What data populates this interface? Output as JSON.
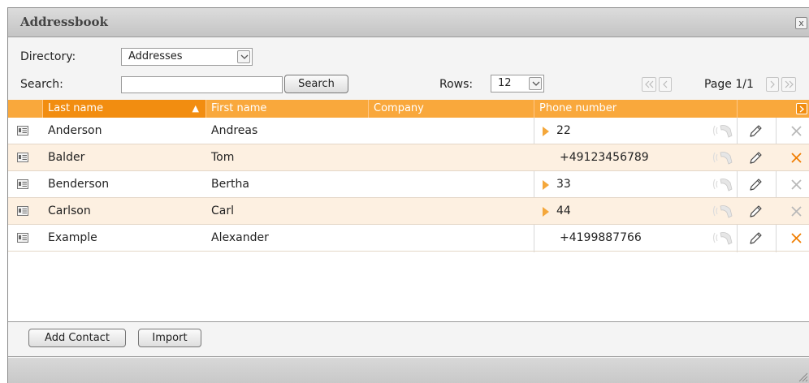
{
  "window": {
    "title": "Addressbook",
    "close_label": "x"
  },
  "toolbar": {
    "directory_label": "Directory:",
    "directory_value": "Addresses",
    "search_label": "Search:",
    "search_value": "",
    "search_button": "Search",
    "rows_label": "Rows:",
    "rows_value": "12",
    "page_label": "Page 1/1"
  },
  "table": {
    "headers": {
      "last_name": "Last name",
      "first_name": "First name",
      "company": "Company",
      "phone": "Phone number"
    },
    "rows": [
      {
        "last": "Anderson",
        "first": "Andreas",
        "company": "",
        "phone": "22",
        "expandable": true
      },
      {
        "last": "Balder",
        "first": "Tom",
        "company": "",
        "phone": "+49123456789",
        "expandable": false
      },
      {
        "last": "Benderson",
        "first": "Bertha",
        "company": "",
        "phone": "33",
        "expandable": true
      },
      {
        "last": "Carlson",
        "first": "Carl",
        "company": "",
        "phone": "44",
        "expandable": true
      },
      {
        "last": "Example",
        "first": "Alexander",
        "company": "",
        "phone": "+4199887766",
        "expandable": false
      }
    ]
  },
  "footer": {
    "add_contact": "Add Contact",
    "import": "Import"
  },
  "colors": {
    "header_orange": "#f9a83c",
    "sorted_header": "#f28d10",
    "alt_row": "#fdf0e1",
    "delete_active": "#f07d00",
    "delete_inactive": "#b8b8b8"
  },
  "icons": {
    "row": "contact-card-icon",
    "expand": "triangle-right-icon",
    "call": "phone-handset-icon",
    "edit": "pencil-icon",
    "delete": "x-icon"
  }
}
